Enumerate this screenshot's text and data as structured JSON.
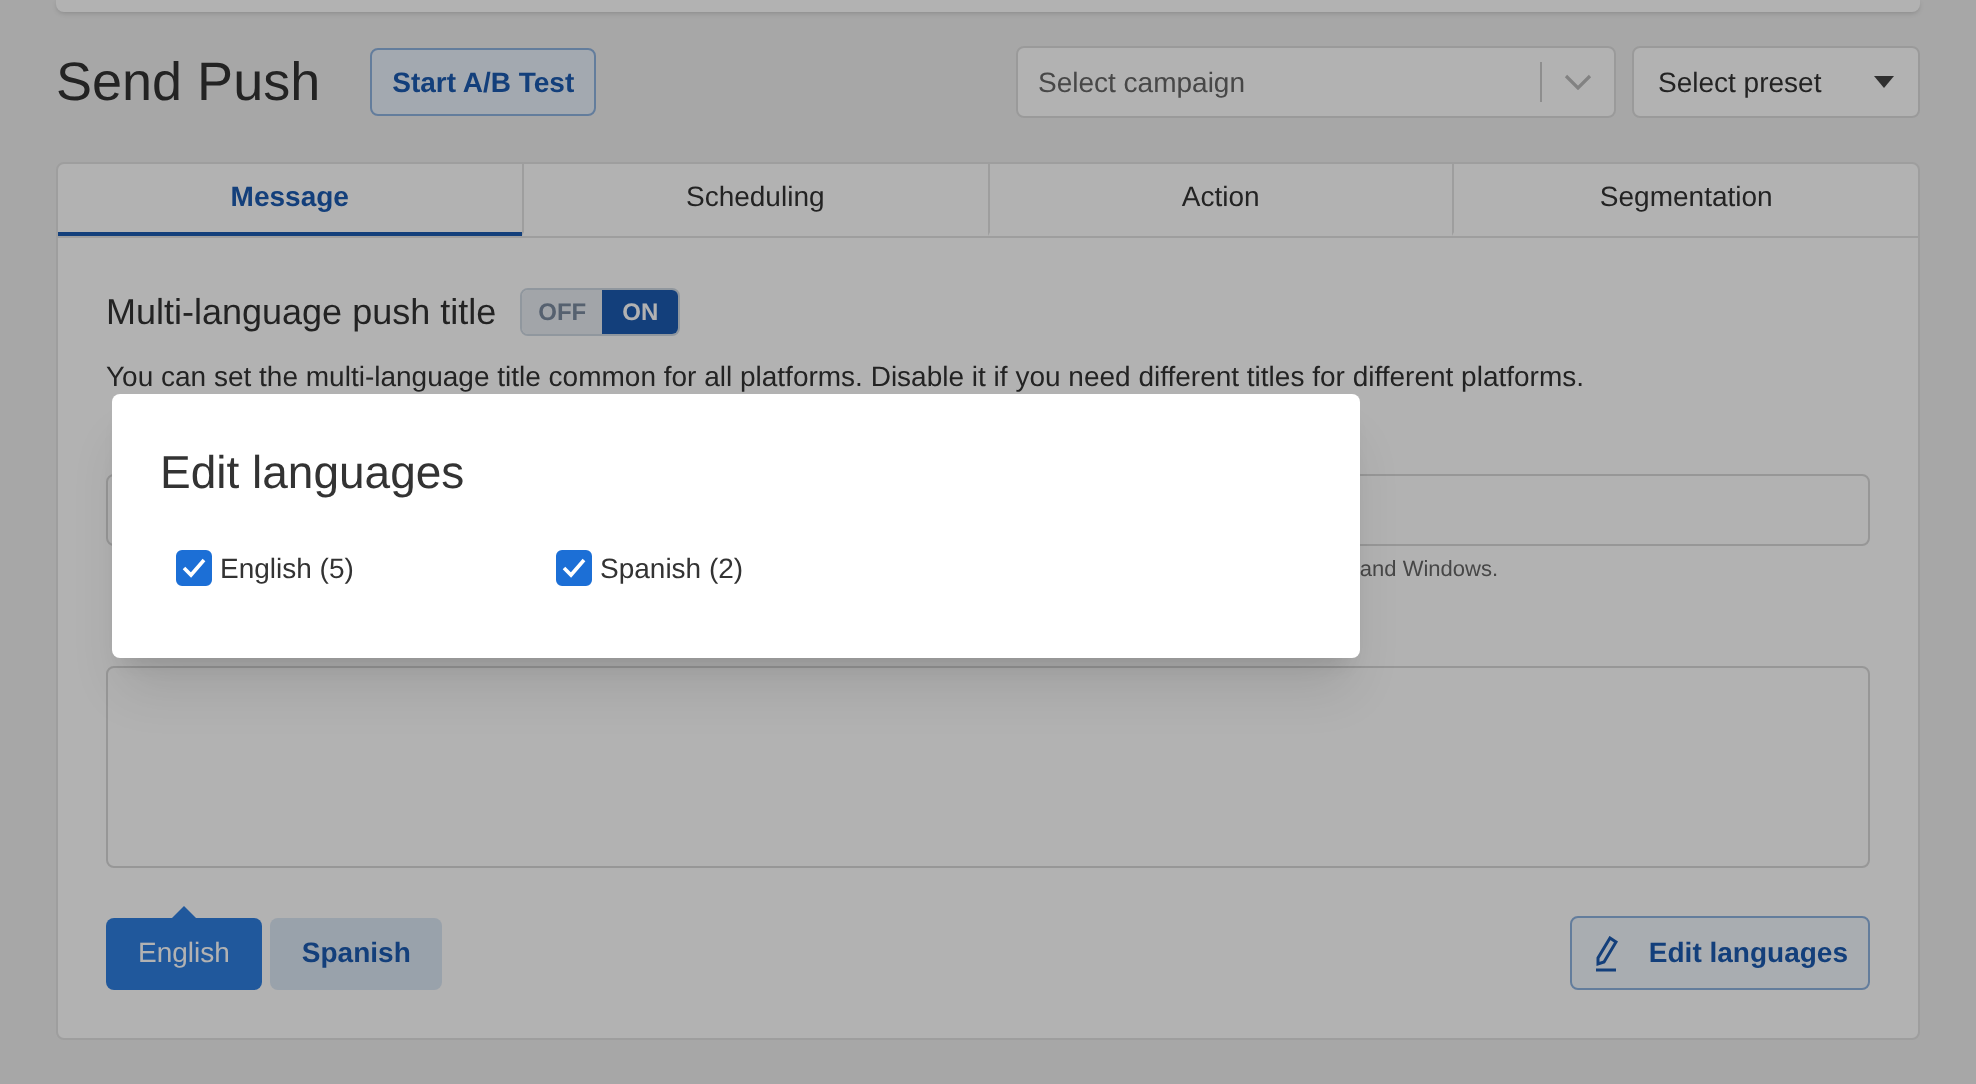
{
  "header": {
    "title": "Send Push",
    "ab_button": "Start A/B Test",
    "campaign_select": {
      "placeholder": "Select campaign"
    },
    "preset_select": {
      "placeholder": "Select preset"
    }
  },
  "tabs": [
    {
      "label": "Message",
      "selected": true
    },
    {
      "label": "Scheduling",
      "selected": false
    },
    {
      "label": "Action",
      "selected": false
    },
    {
      "label": "Segmentation",
      "selected": false
    }
  ],
  "multi_language": {
    "label": "Multi-language push title",
    "toggle": {
      "off_label": "OFF",
      "on_label": "ON",
      "on": true
    },
    "description": "You can set the multi-language title common for all platforms. Disable it if you need different titles for different platforms."
  },
  "title_hint": "and Windows.",
  "language_buttons": [
    {
      "label": "English",
      "selected": true
    },
    {
      "label": "Spanish",
      "selected": false
    }
  ],
  "edit_languages_button": "Edit languages",
  "modal": {
    "title": "Edit languages",
    "languages": [
      {
        "label": "English (5)",
        "checked": true
      },
      {
        "label": "Spanish (2)",
        "checked": true
      }
    ]
  }
}
